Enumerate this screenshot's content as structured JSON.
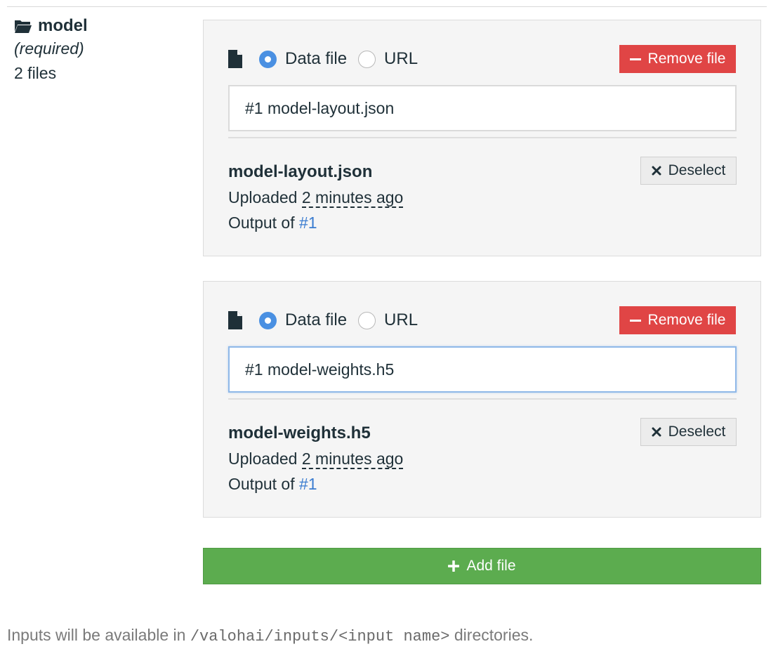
{
  "input": {
    "name": "model",
    "required_label": "(required)",
    "file_count": "2 files"
  },
  "files": [
    {
      "radio_data_file": "Data file",
      "radio_url": "URL",
      "selected_source": "Data file",
      "remove_label": "Remove file",
      "input_value": "#1 model-layout.json",
      "filename": "model-layout.json",
      "uploaded_prefix": "Uploaded",
      "uploaded_time": "2 minutes ago",
      "output_prefix": "Output of",
      "output_link": "#1",
      "deselect_label": "Deselect"
    },
    {
      "radio_data_file": "Data file",
      "radio_url": "URL",
      "selected_source": "Data file",
      "remove_label": "Remove file",
      "input_value": "#1 model-weights.h5",
      "filename": "model-weights.h5",
      "uploaded_prefix": "Uploaded",
      "uploaded_time": "2 minutes ago",
      "output_prefix": "Output of",
      "output_link": "#1",
      "deselect_label": "Deselect"
    }
  ],
  "add_file_label": "Add file",
  "footer": {
    "prefix": "Inputs will be available in",
    "path": "/valohai/inputs/<input name>",
    "suffix": "directories."
  },
  "colors": {
    "remove": "#e04545",
    "add": "#5cac4f",
    "link": "#3a7cd0",
    "radio_checked": "#4a90e2"
  },
  "icons": {
    "input": "folder-open-icon",
    "file": "file-icon",
    "remove": "minus-icon",
    "deselect": "close-icon",
    "add": "plus-icon"
  }
}
